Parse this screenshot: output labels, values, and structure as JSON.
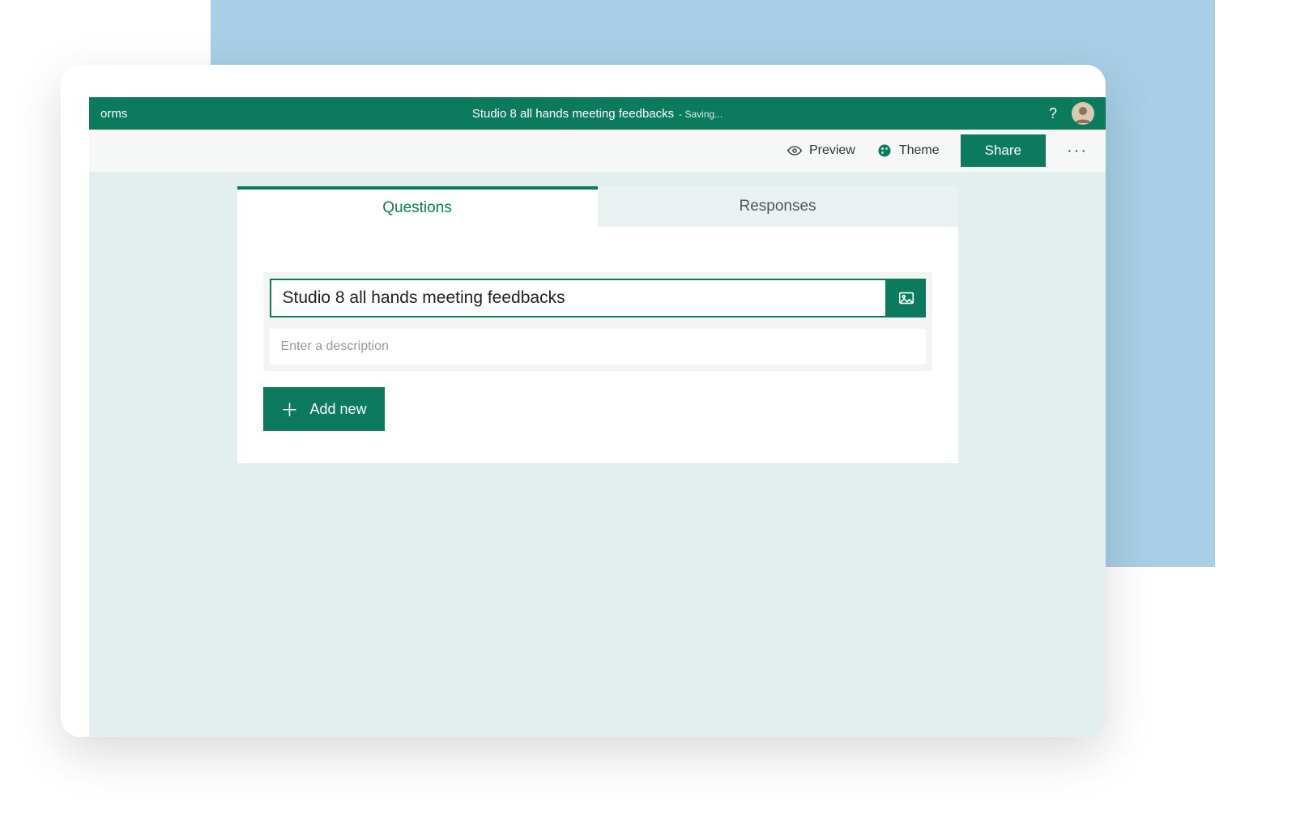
{
  "colors": {
    "brand": "#0c7a5c",
    "accent_bg": "#a8cfe6",
    "app_bg": "#e3eeee"
  },
  "topbar": {
    "app_suffix": "orms",
    "title": "Studio 8 all hands meeting feedbacks",
    "status": "- Saving..."
  },
  "cmdbar": {
    "preview": "Preview",
    "theme": "Theme",
    "share": "Share"
  },
  "tabs": {
    "questions": "Questions",
    "responses": "Responses"
  },
  "form": {
    "title_value": "Studio 8 all hands meeting feedbacks",
    "description_placeholder": "Enter a description",
    "add_new_label": "Add new"
  }
}
